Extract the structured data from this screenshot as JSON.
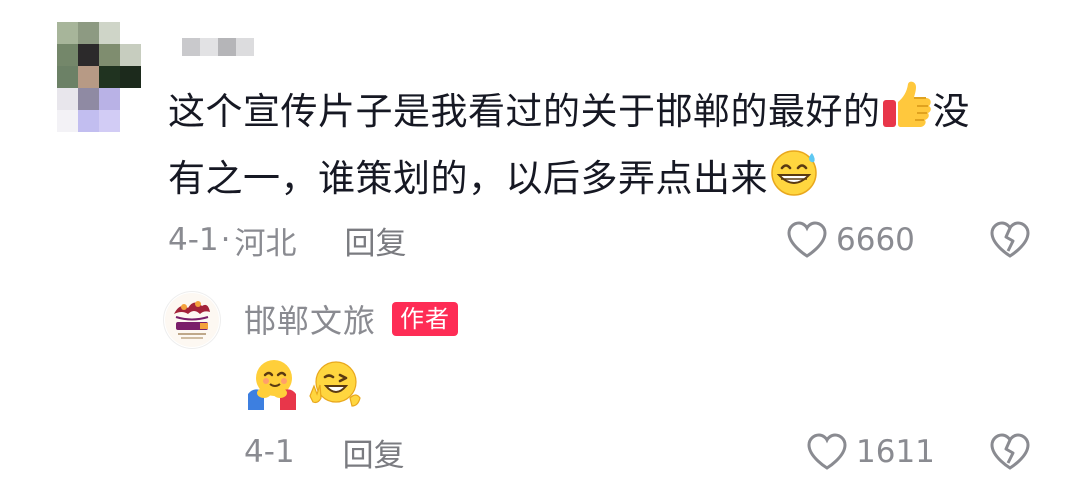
{
  "comment": {
    "text_line1": "这个宣传片子是我看过的关于邯郸的最好的",
    "text_line1_tail": "没",
    "text_line2": "有之一，谁策划的，以后多弄点出来",
    "date": "4-1",
    "separator": "·",
    "location": "河北",
    "reply_label": "回复",
    "like_count": "6660",
    "emoji_1": "thumbs-up",
    "emoji_2": "grinning-sweat"
  },
  "reply": {
    "author_name": "邯郸文旅",
    "author_badge": "作者",
    "emoji_1": "hugging-face",
    "emoji_2": "winking-face-peace",
    "date": "4-1",
    "reply_label": "回复",
    "like_count": "1611"
  },
  "colors": {
    "badge": "#fe2c55",
    "meta_text": "#8a8b91",
    "comment_text": "#161823"
  }
}
